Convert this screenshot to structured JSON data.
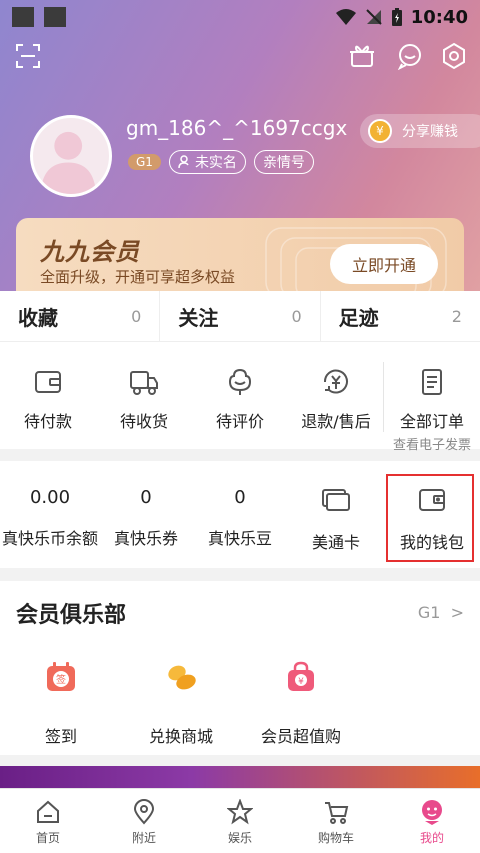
{
  "status": {
    "time": "10:40"
  },
  "profile": {
    "username": "gm_186^_^1697ccgx",
    "level_badge": "G1",
    "tag_unverified": "未实名",
    "tag_family": "亲情号",
    "share_label": "分享赚钱"
  },
  "member": {
    "title": "九九会员",
    "subtitle": "全面升级，开通可享超多权益",
    "cta": "立即开通"
  },
  "stats": [
    {
      "label": "收藏",
      "count": "0"
    },
    {
      "label": "关注",
      "count": "0"
    },
    {
      "label": "足迹",
      "count": "2"
    }
  ],
  "orders": [
    {
      "label": "待付款",
      "icon": "wallet-icon"
    },
    {
      "label": "待收货",
      "icon": "truck-icon"
    },
    {
      "label": "待评价",
      "icon": "review-icon"
    },
    {
      "label": "退款/售后",
      "icon": "refund-icon"
    },
    {
      "label": "全部订单",
      "sub": "查看电子发票",
      "icon": "order-list-icon"
    }
  ],
  "wallet": [
    {
      "value": "0.00",
      "label": "真快乐币余额"
    },
    {
      "value": "0",
      "label": "真快乐券"
    },
    {
      "value": "0",
      "label": "真快乐豆"
    },
    {
      "label": "美通卡",
      "icon": "card-icon"
    },
    {
      "label": "我的钱包",
      "icon": "purse-icon"
    }
  ],
  "club": {
    "title": "会员俱乐部",
    "level": "G1",
    "items": [
      {
        "label": "签到",
        "icon_text": "签"
      },
      {
        "label": "兑换商城"
      },
      {
        "label": "会员超值购",
        "icon_text": "¥"
      }
    ]
  },
  "tabs": [
    {
      "label": "首页"
    },
    {
      "label": "附近"
    },
    {
      "label": "娱乐"
    },
    {
      "label": "购物车"
    },
    {
      "label": "我的"
    }
  ],
  "colors": {
    "accent": "#e84a8c",
    "highlight_box": "#e53030",
    "gold_text": "#7a4a25"
  }
}
